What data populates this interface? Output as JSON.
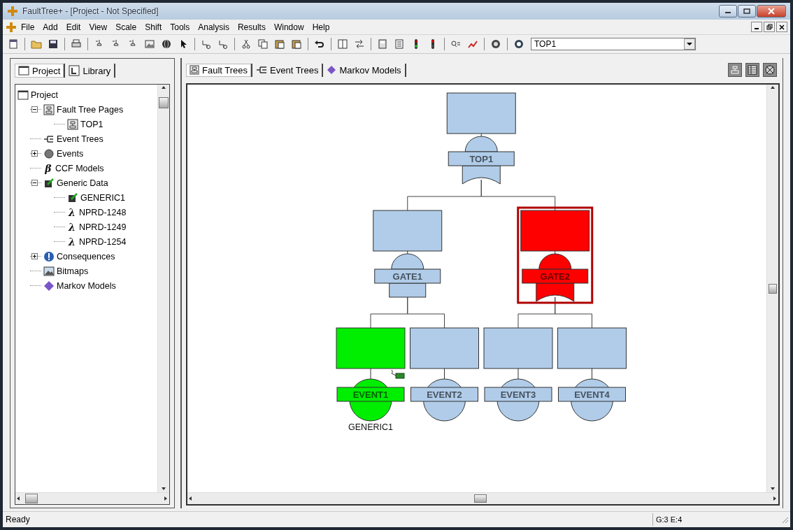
{
  "window": {
    "title": "FaultTree+ - [Project - Not Specified]"
  },
  "menu": [
    "File",
    "Add",
    "Edit",
    "View",
    "Scale",
    "Shift",
    "Tools",
    "Analysis",
    "Results",
    "Window",
    "Help"
  ],
  "toolbar": {
    "combo_value": "TOP1"
  },
  "project_panel": {
    "tabs": [
      {
        "label": "Project",
        "selected": true
      },
      {
        "label": "Library",
        "selected": false
      }
    ],
    "tree": [
      {
        "label": "Project",
        "kind": "project",
        "children": [
          {
            "label": "Fault Tree Pages",
            "kind": "page",
            "expanded": true,
            "children": [
              {
                "label": "TOP1",
                "kind": "page"
              }
            ]
          },
          {
            "label": "Event Trees",
            "kind": "event-tree"
          },
          {
            "label": "Events",
            "kind": "events",
            "expanded": false
          },
          {
            "label": "CCF Models",
            "kind": "glyph",
            "glyph": "β"
          },
          {
            "label": "Generic Data",
            "kind": "generic",
            "expanded": true,
            "children": [
              {
                "label": "GENERIC1",
                "kind": "generic"
              },
              {
                "label": "NPRD-1248",
                "kind": "glyph",
                "glyph": "λ"
              },
              {
                "label": "NPRD-1249",
                "kind": "glyph",
                "glyph": "λ"
              },
              {
                "label": "NPRD-1254",
                "kind": "glyph",
                "glyph": "λ"
              }
            ]
          },
          {
            "label": "Consequences",
            "kind": "consequences",
            "expanded": false
          },
          {
            "label": "Bitmaps",
            "kind": "bitmaps"
          },
          {
            "label": "Markov Models",
            "kind": "markov"
          }
        ]
      }
    ]
  },
  "main_panel": {
    "tabs": [
      {
        "label": "Fault Trees",
        "kind": "fault-tree",
        "selected": true
      },
      {
        "label": "Event Trees",
        "kind": "event-tree",
        "selected": false
      },
      {
        "label": "Markov Models",
        "kind": "markov",
        "selected": false
      }
    ]
  },
  "diagram": {
    "root": {
      "label": "TOP1",
      "kind": "or",
      "color": "#b0cce9",
      "selected": false,
      "children": [
        {
          "label": "GATE1",
          "kind": "and",
          "color": "#b0cce9",
          "selected": false,
          "children": [
            {
              "label": "EVENT1",
              "kind": "basic",
              "color": "#00ee00",
              "selected": false,
              "data_link": "GENERIC1"
            },
            {
              "label": "EVENT2",
              "kind": "basic",
              "color": "#b0cce9",
              "selected": false
            }
          ]
        },
        {
          "label": "GATE2",
          "kind": "or",
          "color": "#ff0000",
          "selected": true,
          "children": [
            {
              "label": "EVENT3",
              "kind": "basic",
              "color": "#b0cce9",
              "selected": false
            },
            {
              "label": "EVENT4",
              "kind": "basic",
              "color": "#b0cce9",
              "selected": false
            }
          ]
        }
      ]
    }
  },
  "status_bar": {
    "message": "Ready",
    "counts": "G:3 E:4"
  }
}
